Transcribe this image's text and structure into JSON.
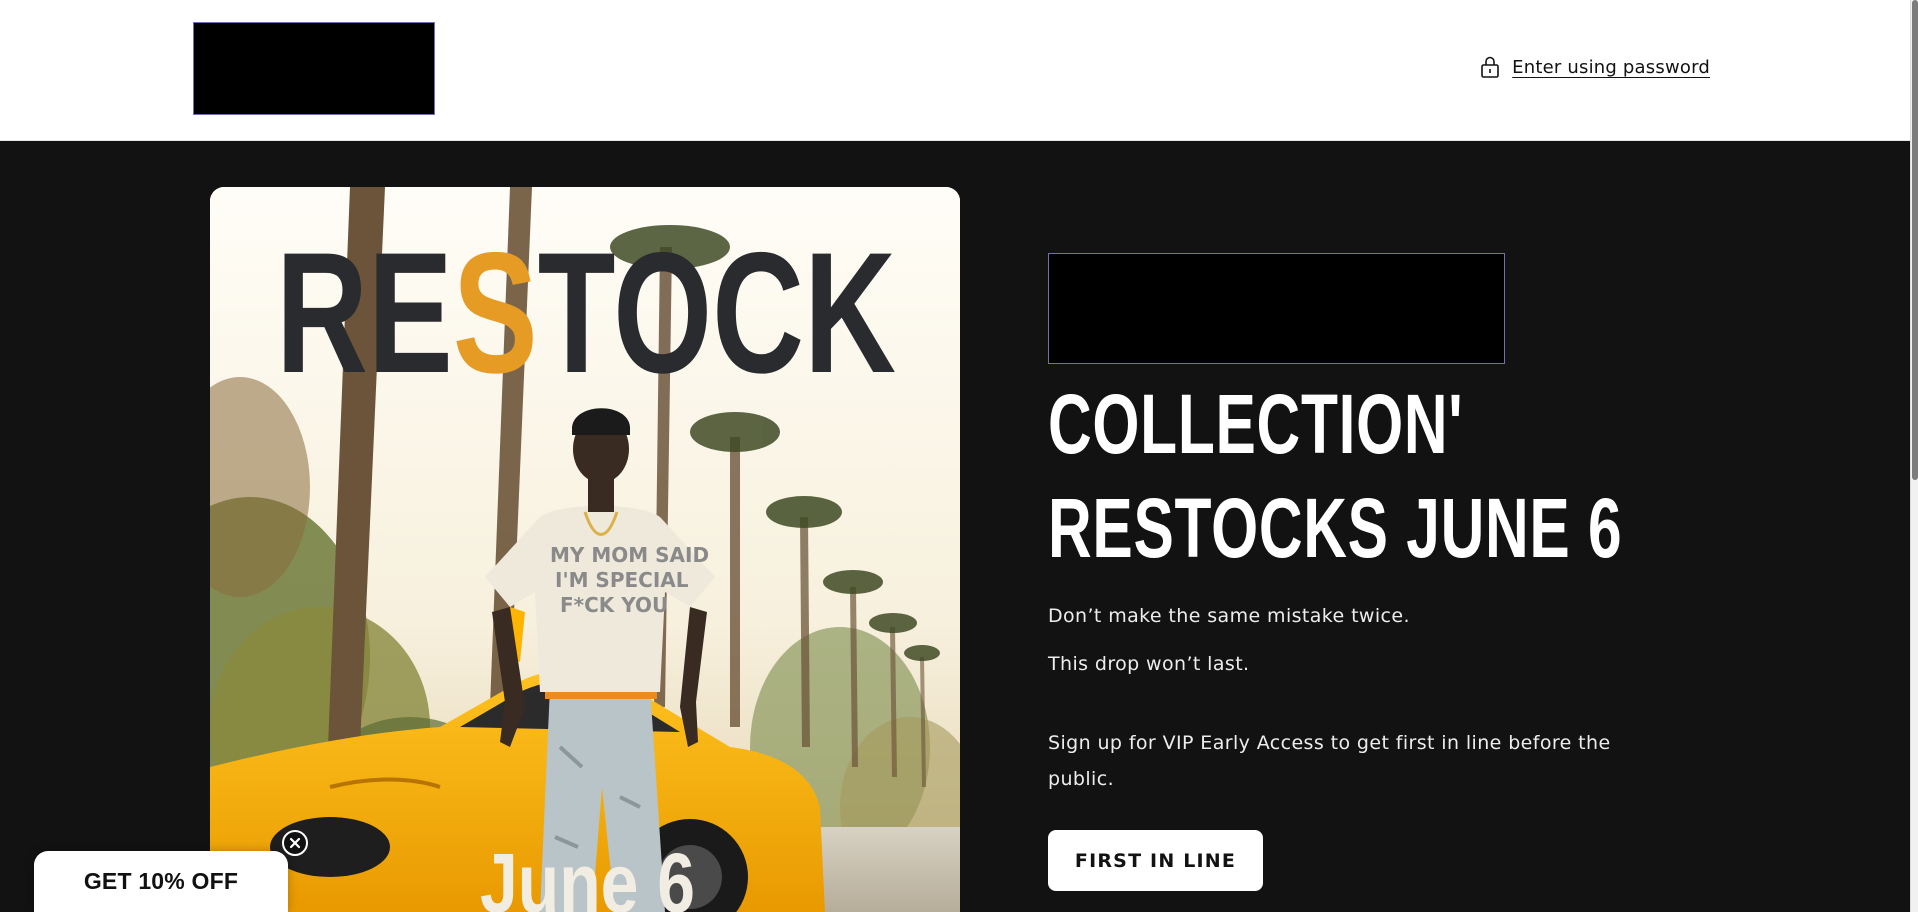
{
  "header": {
    "password_link_label": "Enter using password",
    "lock_icon": "lock-icon"
  },
  "hero": {
    "image": {
      "restock_prefix": "RE",
      "restock_highlight": "S",
      "restock_suffix": "TOCK",
      "shirt_text_line1": "MY MOM SAID",
      "shirt_text_line2": "I'M SPECIAL",
      "shirt_text_line3": "F*CK YOU",
      "date_caption": "June 6",
      "highlight_color": "#e69c24",
      "restock_text_color": "#2a2b2e"
    },
    "title_line1": "COLLECTION'",
    "title_line2": "RESTOCKS JUNE 6",
    "text_line1": "Don’t make the same mistake twice.",
    "text_line2": "This drop won’t last.",
    "text_line3": "Sign up for VIP Early Access to get first in line before the public.",
    "cta_label": "FIRST IN LINE"
  },
  "popup": {
    "discount_label": "GET 10% OFF",
    "close_icon": "close-icon"
  },
  "colors": {
    "page_background": "#121212",
    "header_background": "#ffffff",
    "button_background": "#ffffff"
  }
}
